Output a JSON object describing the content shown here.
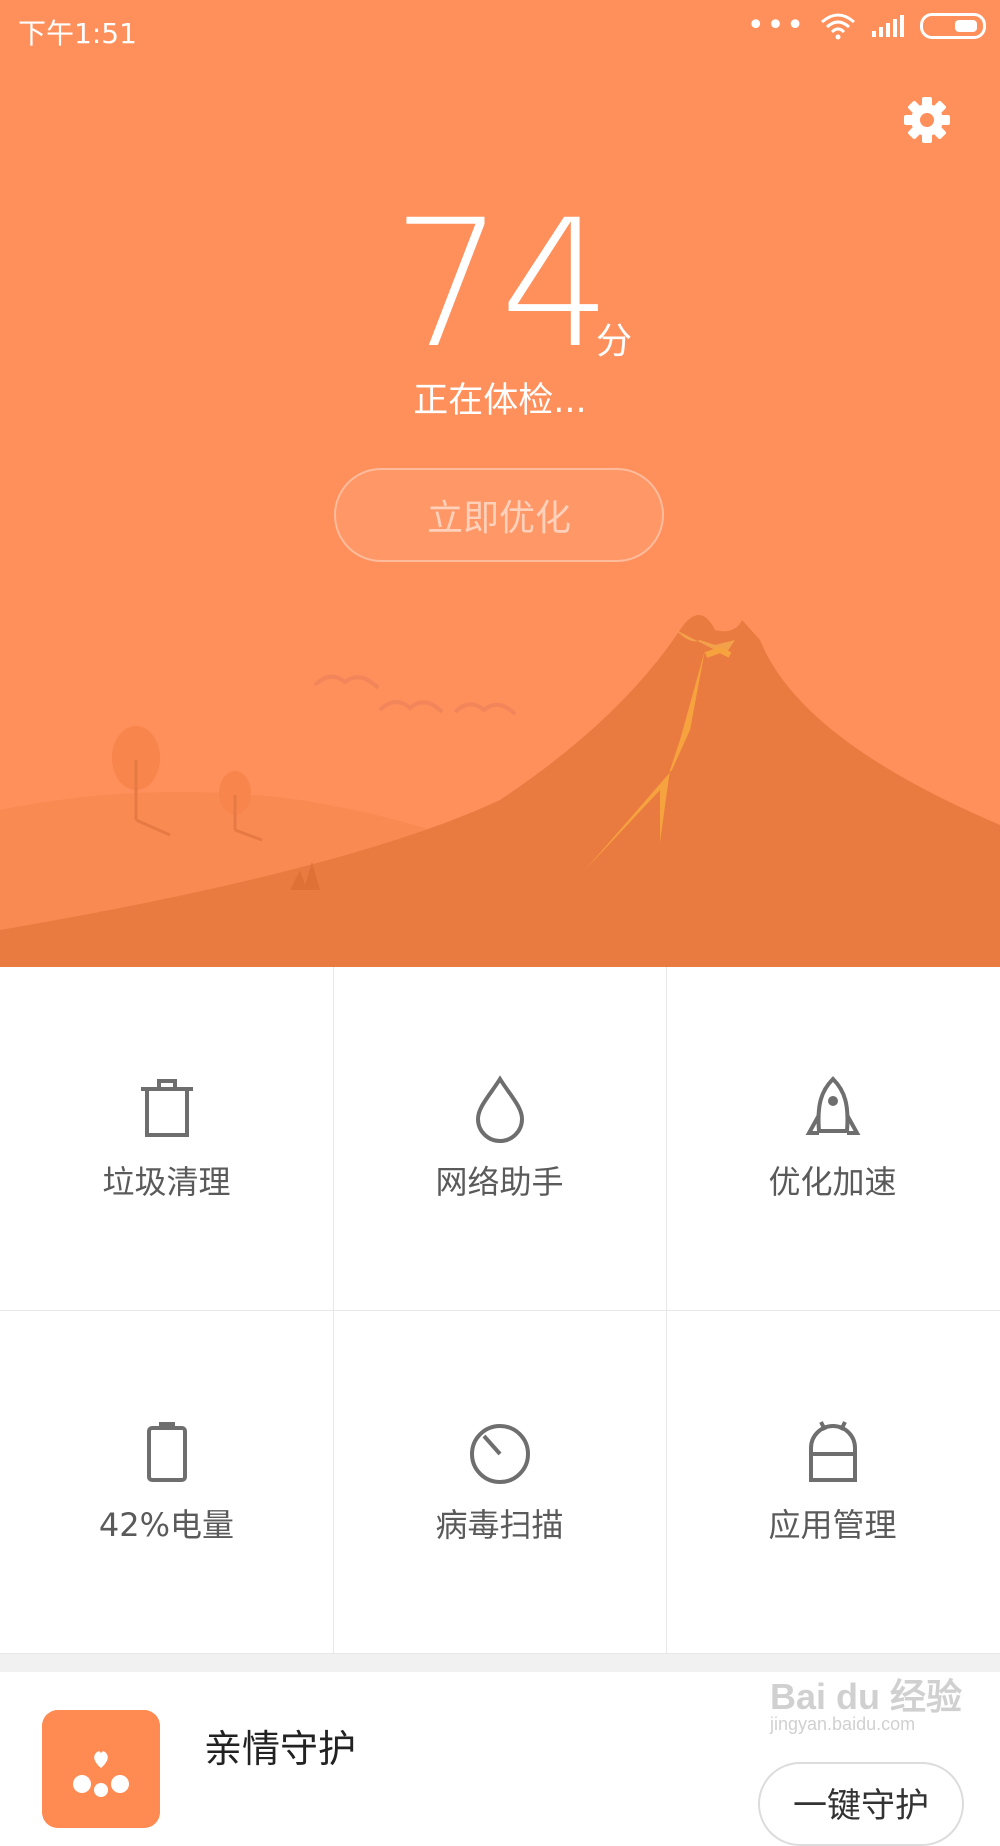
{
  "status_bar": {
    "time": "下午1:51",
    "dots": "•••",
    "icons": [
      "wifi-icon",
      "signal-icon",
      "battery-icon"
    ]
  },
  "header": {
    "settings_icon": "gear-icon"
  },
  "score": {
    "value": "74",
    "unit": "分",
    "status": "正在体检...",
    "button_label": "立即优化"
  },
  "features": [
    {
      "label": "垃圾清理",
      "icon": "trash-icon"
    },
    {
      "label": "网络助手",
      "icon": "drop-icon"
    },
    {
      "label": "优化加速",
      "icon": "rocket-icon"
    },
    {
      "label": "42%电量",
      "icon": "battery-icon"
    },
    {
      "label": "病毒扫描",
      "icon": "scan-icon"
    },
    {
      "label": "应用管理",
      "icon": "android-icon"
    }
  ],
  "bottom_card": {
    "title": "亲情守护",
    "button_label": "一键守护",
    "icon": "family-icon"
  },
  "watermark": {
    "text": "Bai du 经验",
    "url": "jingyan.baidu.com"
  },
  "colors": {
    "accent": "#ff8f5b",
    "mountain": "#e97a3f",
    "text_gray": "#5a5a5a"
  }
}
